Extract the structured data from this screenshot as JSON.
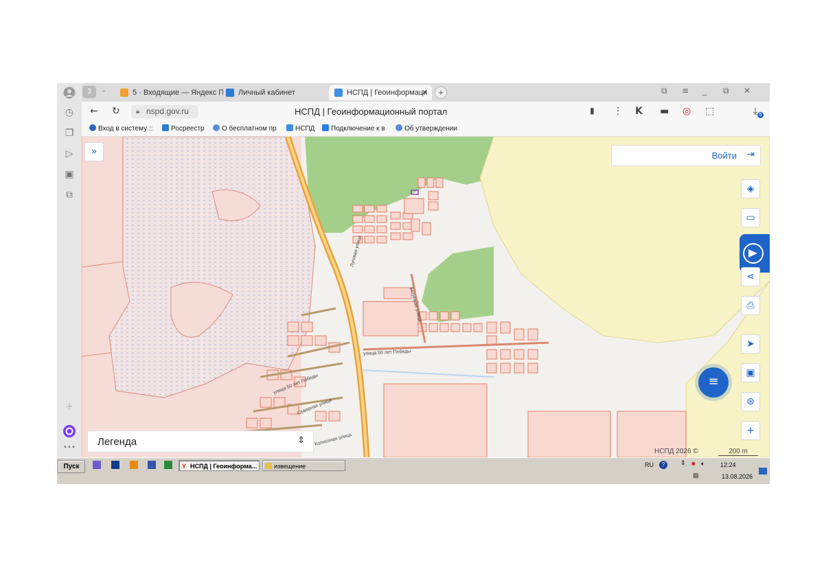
{
  "browser": {
    "rail_badge": "3",
    "tabs": [
      {
        "label": "5 · Входящие — Яндекс П",
        "active": false
      },
      {
        "label": "Личный кабинет",
        "active": false
      },
      {
        "label": "НСПД | Геоинформаци",
        "active": true
      }
    ],
    "url": "nspd.gov.ru",
    "page_title": "НСПД | Геоинформационный портал",
    "download_badge": "5",
    "bookmarks": [
      "Вход в систему ::",
      "Росреестр",
      "О бесплатном пр",
      "НСПД",
      "Подключение к в",
      "Об утверждении"
    ]
  },
  "map": {
    "login_label": "Войти",
    "legend_label": "Легенда",
    "attribution": "НСПД 2026 ©",
    "scale_label": "200 m",
    "street_labels": [
      "Луговая улица",
      "Бегинная улица",
      "улица 50 лет Победы",
      "улица 50 лет Победы",
      "Северная улица",
      "Колхозная улица"
    ]
  },
  "taskbar": {
    "start_label": "Пуск",
    "tasks": [
      "НСПД | Геоинформа...",
      "извещение"
    ],
    "lang": "RU",
    "time": "12:24",
    "date": "13.08.2026"
  },
  "colors": {
    "forest": "#a4cf8a",
    "yellow_zone": "#f7f3c6",
    "parcel_fill": "#f7d9d1",
    "parcel_stroke": "#e07a64",
    "road": "#e9a23b",
    "accent": "#1f64c9"
  }
}
